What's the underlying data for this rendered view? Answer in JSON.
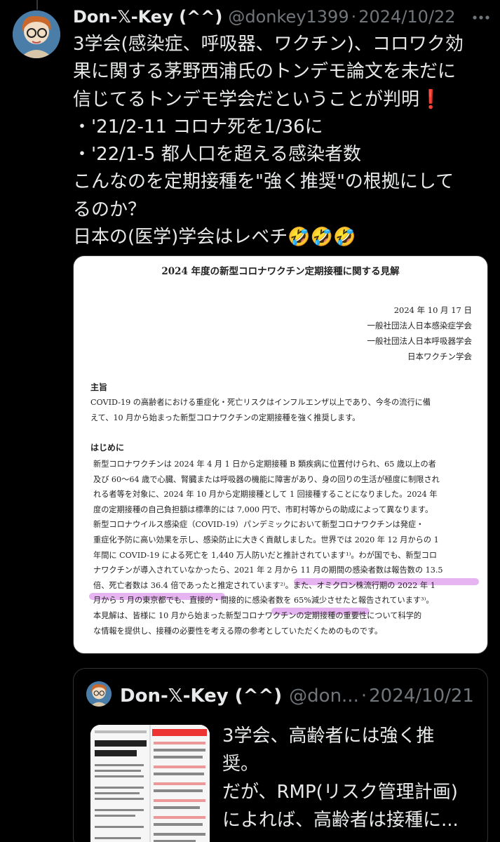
{
  "tweet": {
    "display_name": "Don-𝕏-Key (^^)",
    "handle": "@donkey1399",
    "separator": "·",
    "date": "2024/10/22",
    "lines": [
      "3学会(感染症、呼吸器、ワクチン)、コロワク効",
      "果に関する茅野西浦氏のトンデモ論文を未だに",
      "信じてるトンデモ学会だということが判明",
      "・'21/2-11 コロナ死を1/36に",
      "・'22/1-5 都人口を超える感染者数",
      "こんなのを定期接種を\"強く推奨\"の根拠にして",
      "るのか？",
      "日本の(医学)学会はレベチ🤣🤣🤣"
    ],
    "exclamation": "❗"
  },
  "document": {
    "title": "2024 年度の新型コロナワクチン定期接種に関する見解",
    "meta": [
      "2024 年 10 月 17 日",
      "一般社団法人日本感染症学会",
      "一般社団法人日本呼吸器学会",
      "日本ワクチン学会"
    ],
    "heading_summary": "主旨",
    "summary_lines": [
      "COVID-19 の高齢者における重症化・死亡リスクはインフルエンザ以上であり、今冬の流行に備",
      "えて、10 月から始まった新型コロナワクチンの定期接種を強く推奨します。"
    ],
    "heading_intro": "はじめに",
    "intro_lines": [
      "新型コロナワクチンは 2024 年 4 月 1 日から定期接種 B 類疾病に位置付けられ、65 歳以上の者",
      "及び 60～64 歳で心臓、腎臓または呼吸器の機能に障害があり、身の回りの生活が極度に制限され",
      "れる者等を対象に、2024 年 10 月から定期接種として 1 回接種することになりました。2024 年",
      "度の定期接種の自己負担額は標準的には 7,000 円で、市町村等からの助成によって異なります。",
      "新型コロナウイルス感染症（COVID-19）パンデミックにおいて新型コロナワクチンは発症・",
      "重症化予防に高い効果を示し、感染防止に大きく貢献しました。世界では 2020 年 12 月からの 1",
      "年間に COVID-19 による死亡を 1,440 万人防いだと推計されています¹⁾。わが国でも、新型コロ",
      "ナワクチンが導入されていなかったら、2021 年 2 月から 11 月の期間の感染者数は報告数の 13.5",
      "倍、死亡者数は 36.4 倍であったと推定されています²⁾。また、オミクロン株流行期の 2022 年 1",
      "月から 5 月の東京都でも、直接的・間接的に感染者数を 65%減少させたと報告されています³⁾。",
      "本見解は、皆様に 10 月から始まった新型コロナワクチンの定期接種の重要性について科学的",
      "な情報を提供し、接種の必要性を考える際の参考としていただくためのものです。"
    ]
  },
  "quote": {
    "display_name": "Don-𝕏-Key (^^)",
    "handle": "@don...",
    "separator": "·",
    "date": "2024/10/21",
    "lines": [
      "3学会、高齢者には強く推",
      "奨。",
      "だが、RMP(リスク管理計画)",
      "によれば、高齢者は接種に..."
    ]
  },
  "colors": {
    "background": "#000000",
    "text": "#e7e9ea",
    "muted": "#71767b",
    "highlight": "#d278e6"
  },
  "icons": {
    "more": "more-horizontal-icon",
    "exclamation": "red-exclamation-emoji",
    "laugh": "rolling-laughing-emoji"
  }
}
